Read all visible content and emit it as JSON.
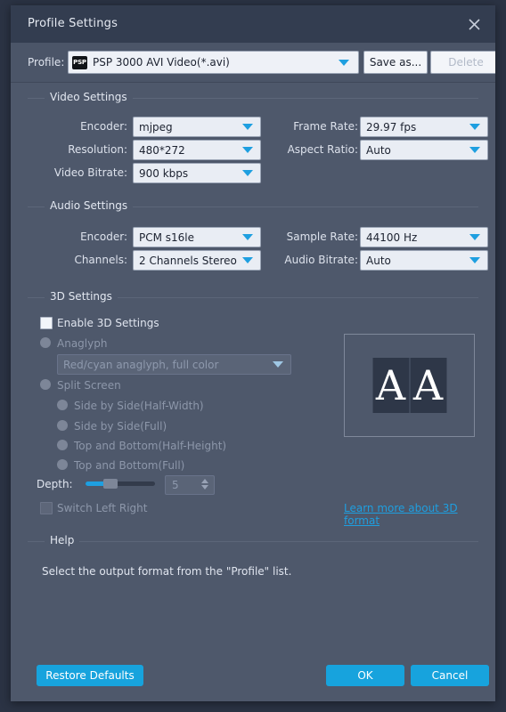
{
  "window": {
    "title": "Profile Settings",
    "close_icon": "close-icon"
  },
  "profile": {
    "label": "Profile:",
    "icon_text": "PSP",
    "value": "PSP 3000 AVI Video(*.avi)",
    "save_as_label": "Save as...",
    "delete_label": "Delete"
  },
  "video_settings": {
    "title": "Video Settings",
    "fields": [
      {
        "label": "Encoder:",
        "value": "mjpeg"
      },
      {
        "label": "Resolution:",
        "value": "480*272"
      },
      {
        "label": "Video Bitrate:",
        "value": "900 kbps"
      },
      {
        "label": "Frame Rate:",
        "value": "29.97 fps"
      },
      {
        "label": "Aspect Ratio:",
        "value": "Auto"
      }
    ]
  },
  "audio_settings": {
    "title": "Audio Settings",
    "fields": [
      {
        "label": "Encoder:",
        "value": "PCM s16le"
      },
      {
        "label": "Channels:",
        "value": "2 Channels Stereo"
      },
      {
        "label": "Sample Rate:",
        "value": "44100 Hz"
      },
      {
        "label": "Audio Bitrate:",
        "value": "Auto"
      }
    ]
  },
  "threed_settings": {
    "title": "3D Settings",
    "enable_label": "Enable 3D Settings",
    "anaglyph_label": "Anaglyph",
    "anaglyph_value": "Red/cyan anaglyph, full color",
    "split_screen_label": "Split Screen",
    "split_options": [
      "Side by Side(Half-Width)",
      "Side by Side(Full)",
      "Top and Bottom(Half-Height)",
      "Top and Bottom(Full)"
    ],
    "depth_label": "Depth:",
    "depth_value": "5",
    "switch_left_right_label": "Switch Left Right",
    "learn_more_label": "Learn more about 3D format",
    "preview_glyph_left": "A",
    "preview_glyph_right": "A"
  },
  "help": {
    "title": "Help",
    "text": "Select the output format from the \"Profile\" list."
  },
  "footer": {
    "restore_label": "Restore Defaults",
    "ok_label": "OK",
    "cancel_label": "Cancel"
  },
  "colors": {
    "accent": "#1e9fe0",
    "button": "#17a3dd",
    "dialog_bg": "#4e586b",
    "titlebar_bg": "#333d50"
  }
}
